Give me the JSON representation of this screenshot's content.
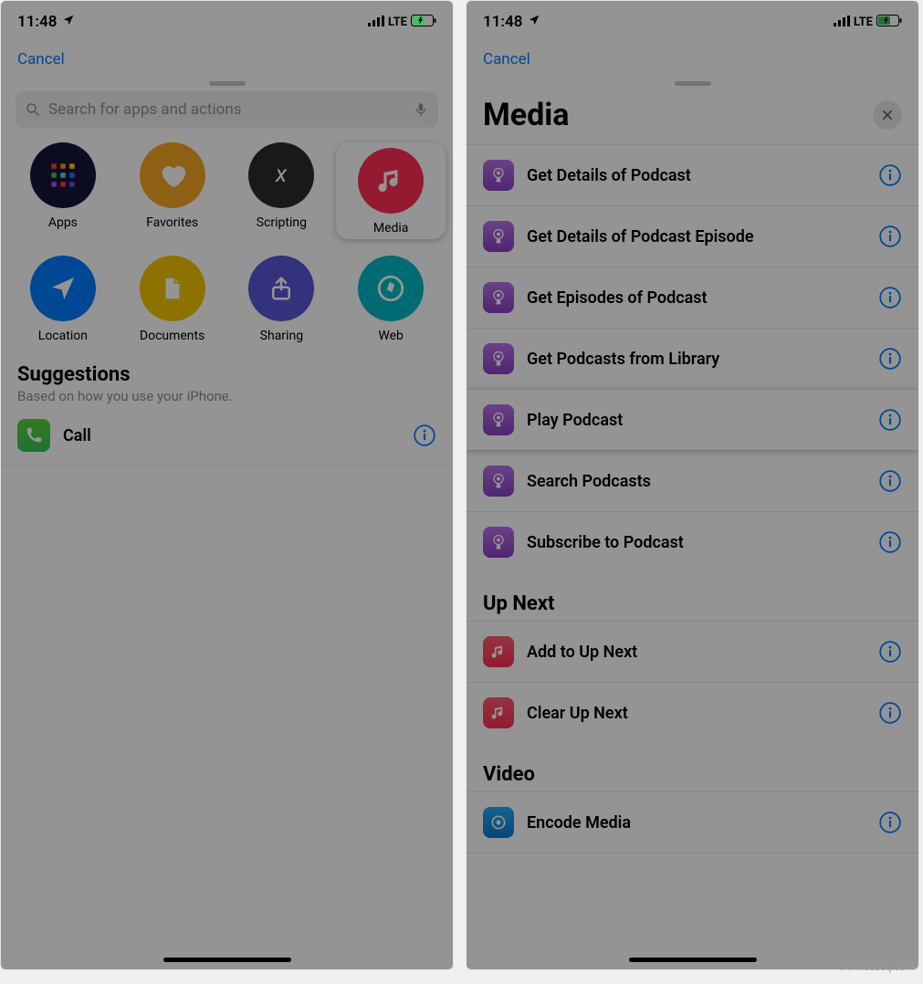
{
  "status": {
    "time": "11:48",
    "carrier": "LTE"
  },
  "nav": {
    "cancel": "Cancel"
  },
  "left": {
    "search_placeholder": "Search for apps and actions",
    "categories": [
      {
        "label": "Apps"
      },
      {
        "label": "Favorites"
      },
      {
        "label": "Scripting"
      },
      {
        "label": "Media"
      },
      {
        "label": "Location"
      },
      {
        "label": "Documents"
      },
      {
        "label": "Sharing"
      },
      {
        "label": "Web"
      }
    ],
    "suggestions_title": "Suggestions",
    "suggestions_sub": "Based on how you use your iPhone.",
    "suggestions": [
      {
        "label": "Call"
      }
    ]
  },
  "right": {
    "title": "Media",
    "podcast_actions": [
      {
        "label": "Get Details of Podcast"
      },
      {
        "label": "Get Details of Podcast Episode"
      },
      {
        "label": "Get Episodes of Podcast"
      },
      {
        "label": "Get Podcasts from Library"
      },
      {
        "label": "Play Podcast"
      },
      {
        "label": "Search Podcasts"
      },
      {
        "label": "Subscribe to Podcast"
      }
    ],
    "upnext_title": "Up Next",
    "upnext_actions": [
      {
        "label": "Add to Up Next"
      },
      {
        "label": "Clear Up Next"
      }
    ],
    "video_title": "Video",
    "video_actions": [
      {
        "label": "Encode Media"
      }
    ]
  },
  "watermark": "www.deuaq.com"
}
